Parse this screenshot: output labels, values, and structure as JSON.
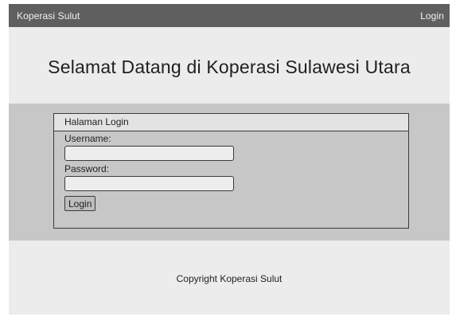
{
  "navbar": {
    "brand": "Koperasi Sulut",
    "login_link": "Login"
  },
  "hero": {
    "title": "Selamat Datang di Koperasi Sulawesi Utara"
  },
  "login_form": {
    "title": "Halaman Login",
    "username_label": "Username:",
    "username_value": "",
    "password_label": "Password:",
    "password_value": "",
    "submit_label": "Login"
  },
  "footer": {
    "copyright": "Copyright Koperasi Sulut"
  },
  "colors": {
    "navbar_bg": "#5f5f5f",
    "hero_bg": "#ececec",
    "band_bg": "#c7c7c7",
    "footer_bg": "#ececec"
  }
}
